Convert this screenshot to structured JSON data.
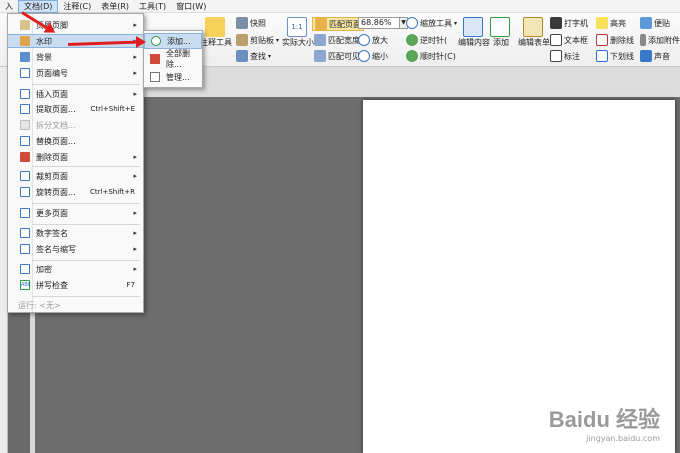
{
  "menubar": {
    "items": [
      "入",
      "文档(D)",
      "注释(C)",
      "表单(R)",
      "工具(T)",
      "窗口(W)"
    ]
  },
  "ribbon": {
    "snapshot": "快照",
    "clipboard": "剪贴板",
    "find": "查找",
    "annot_tool": "注释工具",
    "actual_size": "实际大小",
    "fit_page": "匹配页面",
    "fit_width": "匹配宽度",
    "fit_visible": "匹配可见",
    "zoom_value": "68.86%",
    "zoom_in": "放大",
    "zoom_out": "缩小",
    "zoom_tool": "缩放工具",
    "rotate_left": "逆时针(",
    "rotate_right": "顺时针(C)",
    "edit_content": "编辑内容",
    "add": "添加",
    "edit_form": "编辑表单",
    "typewriter": "打字机",
    "textbox": "文本框",
    "callout": "标注",
    "highlight": "高亮",
    "strikeout": "删除线",
    "underline": "下划线",
    "note": "便贴",
    "attach": "添加附件",
    "sound": "声音"
  },
  "menu": {
    "items": [
      {
        "label": "页眉页脚",
        "arrow": "▸"
      },
      {
        "label": "水印",
        "arrow": "▸"
      },
      {
        "label": "背景",
        "arrow": "▸"
      },
      {
        "label": "页面编号",
        "arrow": "▸"
      },
      {
        "label": "插入页面",
        "arrow": "▸"
      },
      {
        "label": "提取页面...",
        "shortcut": "Ctrl+Shift+E"
      },
      {
        "label": "拆分文档..."
      },
      {
        "label": "替换页面..."
      },
      {
        "label": "删除页面",
        "arrow": "▸"
      },
      {
        "label": "裁剪页面",
        "arrow": "▸"
      },
      {
        "label": "旋转页面...",
        "shortcut": "Ctrl+Shift+R"
      },
      {
        "label": "更多页面",
        "arrow": "▸"
      },
      {
        "label": "数字签名",
        "arrow": "▸"
      },
      {
        "label": "签名与缩写",
        "arrow": "▸"
      },
      {
        "label": "加密",
        "arrow": "▸"
      },
      {
        "label": "拼写检查",
        "shortcut": "F7"
      },
      {
        "label": "运行: <无>"
      }
    ]
  },
  "submenu": {
    "items": [
      {
        "label": "添加..."
      },
      {
        "label": "全部删除..."
      },
      {
        "label": "管理..."
      }
    ]
  },
  "watermark": {
    "brand": "Baidu 经验",
    "url": "jingyan.baidu.com"
  },
  "colors": {
    "highlight": "#c8ddf2",
    "arrow": "#e02020",
    "page": "#ffffff",
    "canvas": "#6d6d6d"
  }
}
